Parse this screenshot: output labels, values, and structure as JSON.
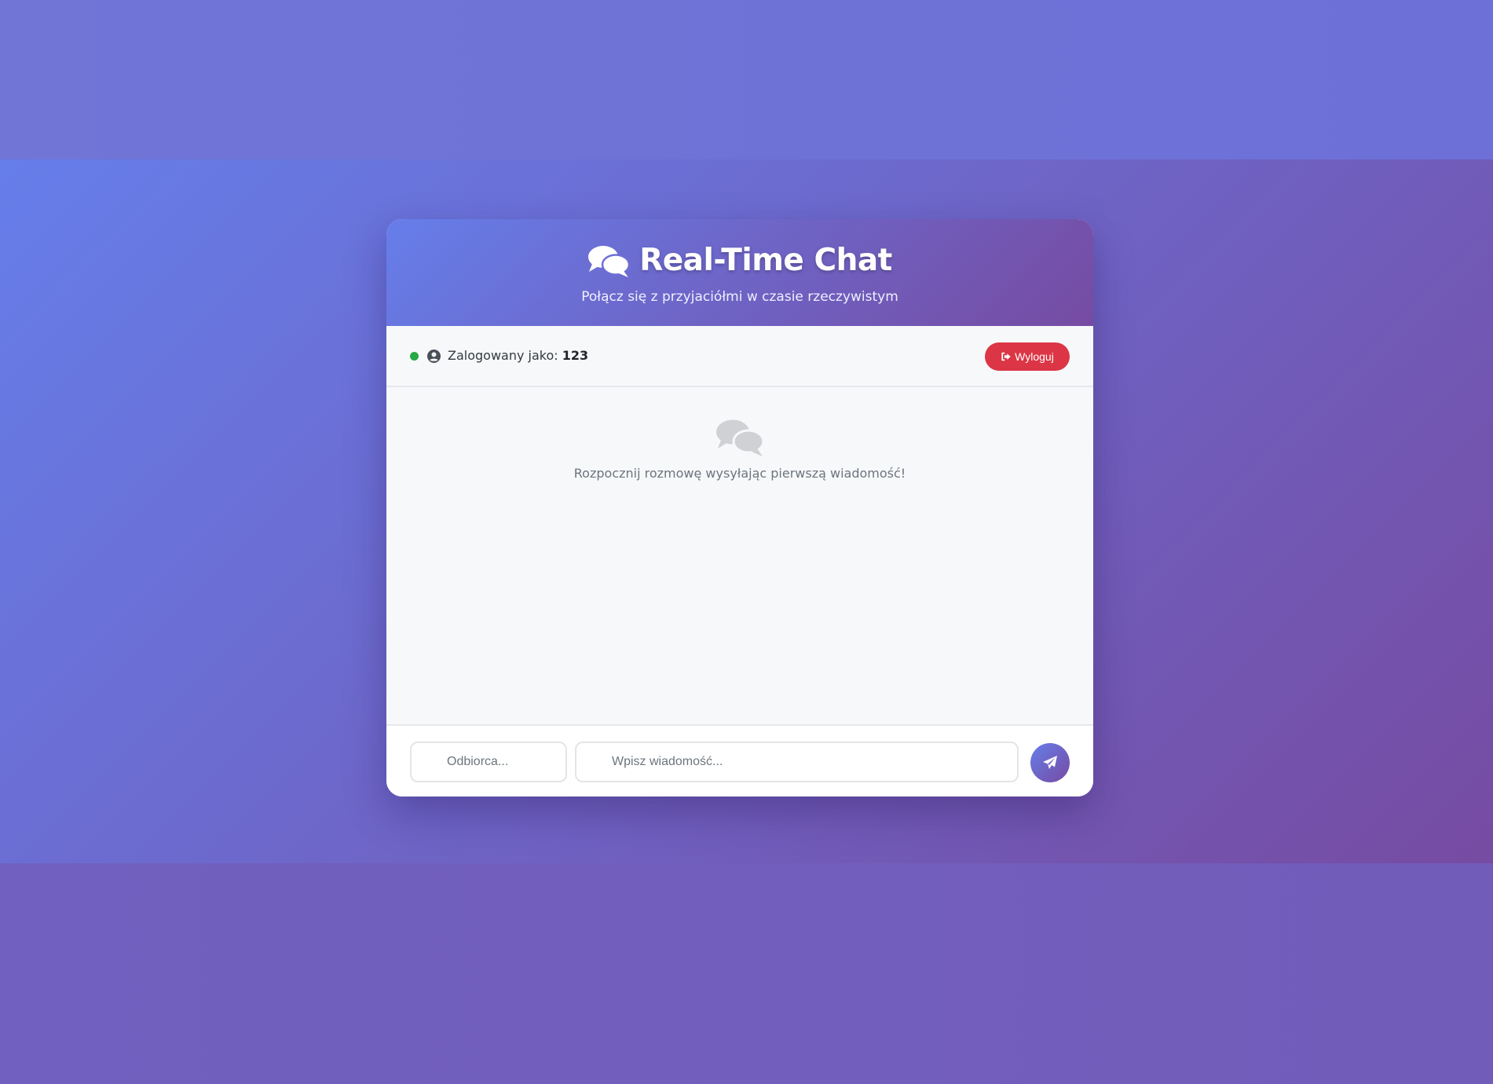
{
  "header": {
    "title": "Real-Time Chat",
    "subtitle": "Połącz się z przyjaciółmi w czasie rzeczywistym",
    "icon": "comments-icon"
  },
  "status": {
    "online": true,
    "label": "Zalogowany jako:",
    "username": "123",
    "logout_label": "Wyloguj",
    "logout_icon": "sign-out-icon"
  },
  "messages": {
    "empty_text": "Rozpocznij rozmowę wysyłając pierwszą wiadomość!",
    "empty_icon": "comments-icon"
  },
  "composer": {
    "recipient_placeholder": "Odbiorca...",
    "recipient_value": "",
    "message_placeholder": "Wpisz wiadomość...",
    "message_value": "",
    "send_icon": "paper-plane-icon"
  },
  "colors": {
    "accent_start": "#667eea",
    "accent_end": "#764ba2",
    "online": "#28a745",
    "danger": "#dc3545"
  }
}
